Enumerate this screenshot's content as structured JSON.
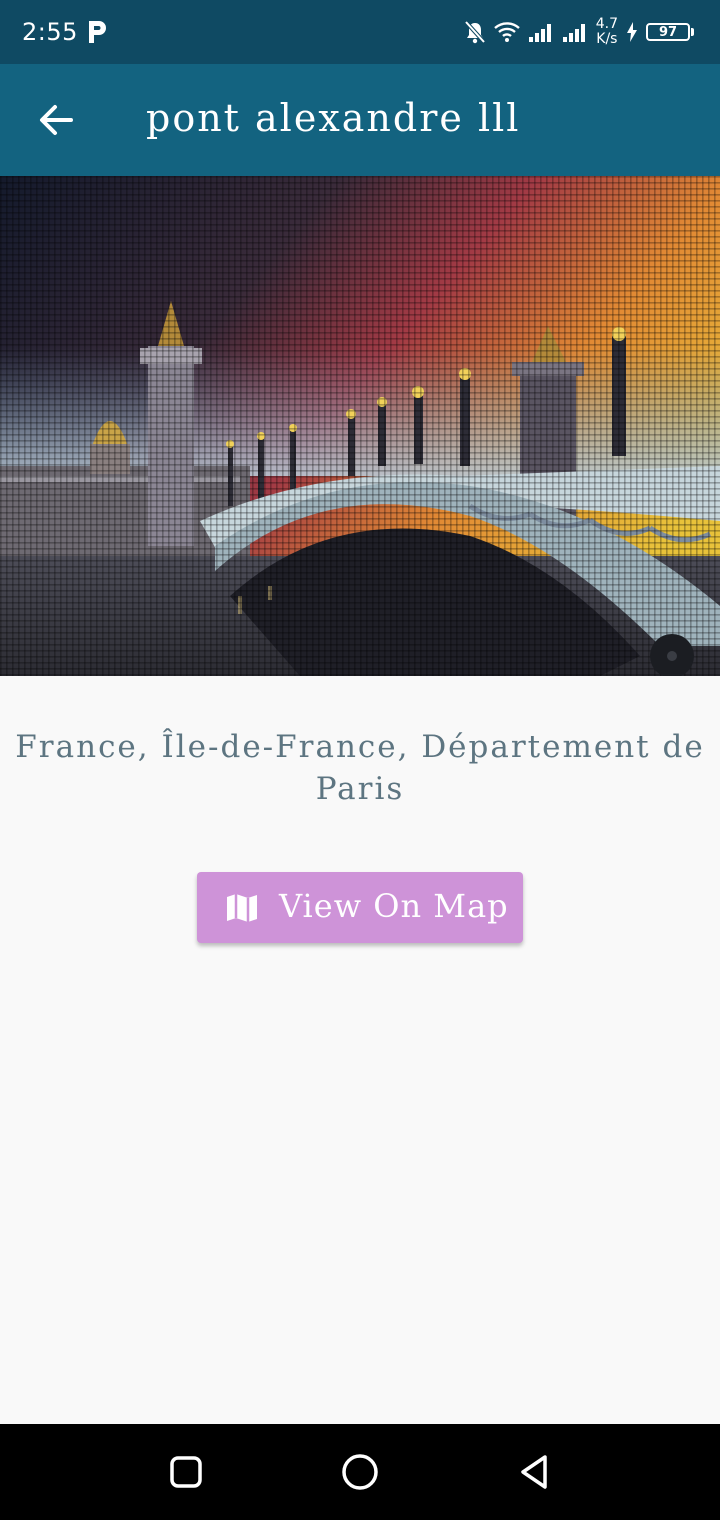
{
  "status_bar": {
    "time": "2:55",
    "net_speed_value": "4.7",
    "net_speed_unit": "K/s",
    "battery_level": "97",
    "icons": [
      "p-notification-icon",
      "bell-off-icon",
      "wifi-icon",
      "signal-icon",
      "signal-icon",
      "charging-icon"
    ]
  },
  "app_bar": {
    "title": "pont alexandre lll",
    "back_icon": "arrow-left-icon"
  },
  "place": {
    "location": "France, Île-de-France, Département de Paris"
  },
  "actions": {
    "view_on_map_label": "View On Map",
    "view_on_map_icon": "map-icon"
  },
  "nav_bar": {
    "icons": [
      "recents-square-icon",
      "home-circle-icon",
      "back-triangle-icon"
    ]
  },
  "colors": {
    "status_bar": "#0f4a63",
    "app_bar": "#136380",
    "location_text": "#5d7581",
    "button": "#ce93d8",
    "background": "#f9f9f9"
  }
}
